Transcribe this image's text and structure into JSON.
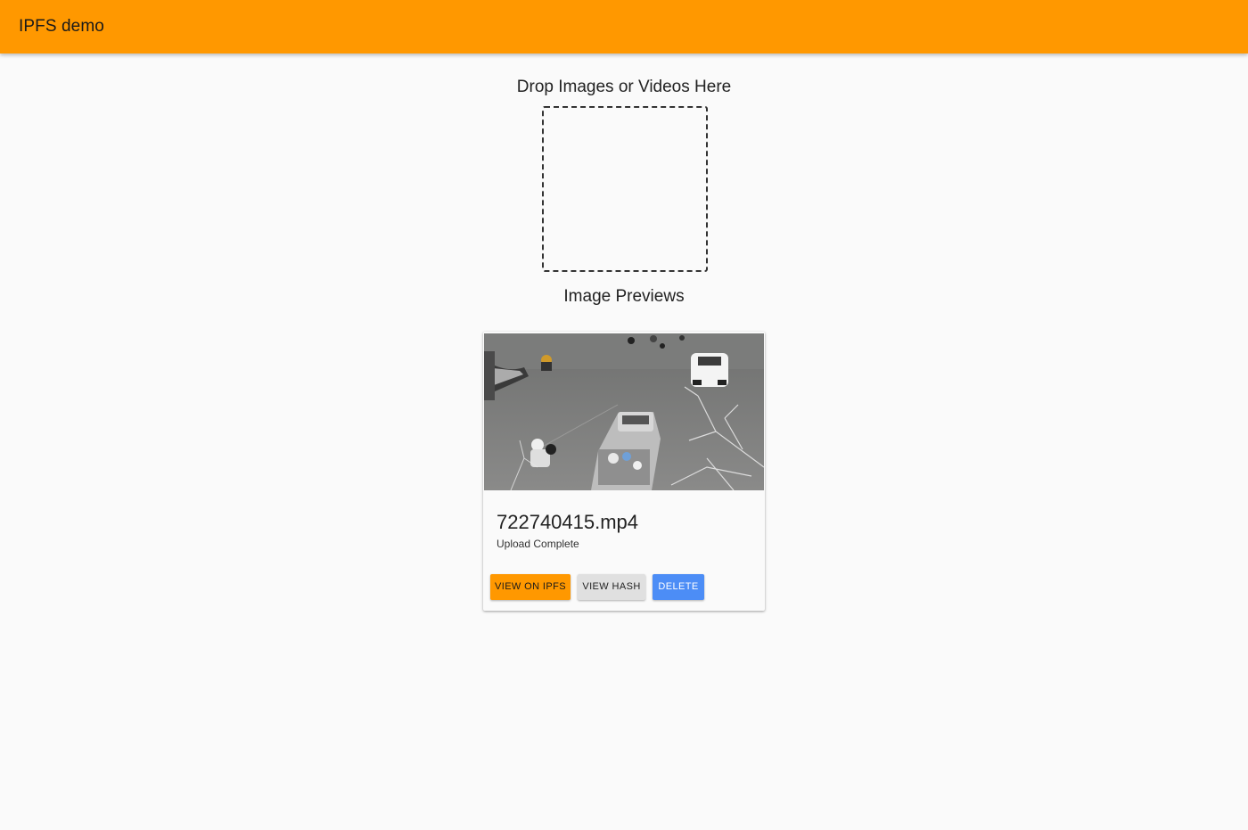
{
  "appbar": {
    "title": "IPFS demo",
    "color": "#ff9800"
  },
  "dropzone": {
    "heading": "Drop Images or Videos Here"
  },
  "previews": {
    "heading": "Image Previews",
    "items": [
      {
        "filename": "722740415.mp4",
        "status": "Upload Complete",
        "thumbnail": "video-thumbnail",
        "actions": {
          "view_ipfs": "VIEW ON IPFS",
          "view_hash": "VIEW HASH",
          "delete": "DELETE"
        }
      }
    ]
  },
  "colors": {
    "accent": "#ff9800",
    "delete": "#4c8df6",
    "secondary": "#e0e0e0"
  }
}
